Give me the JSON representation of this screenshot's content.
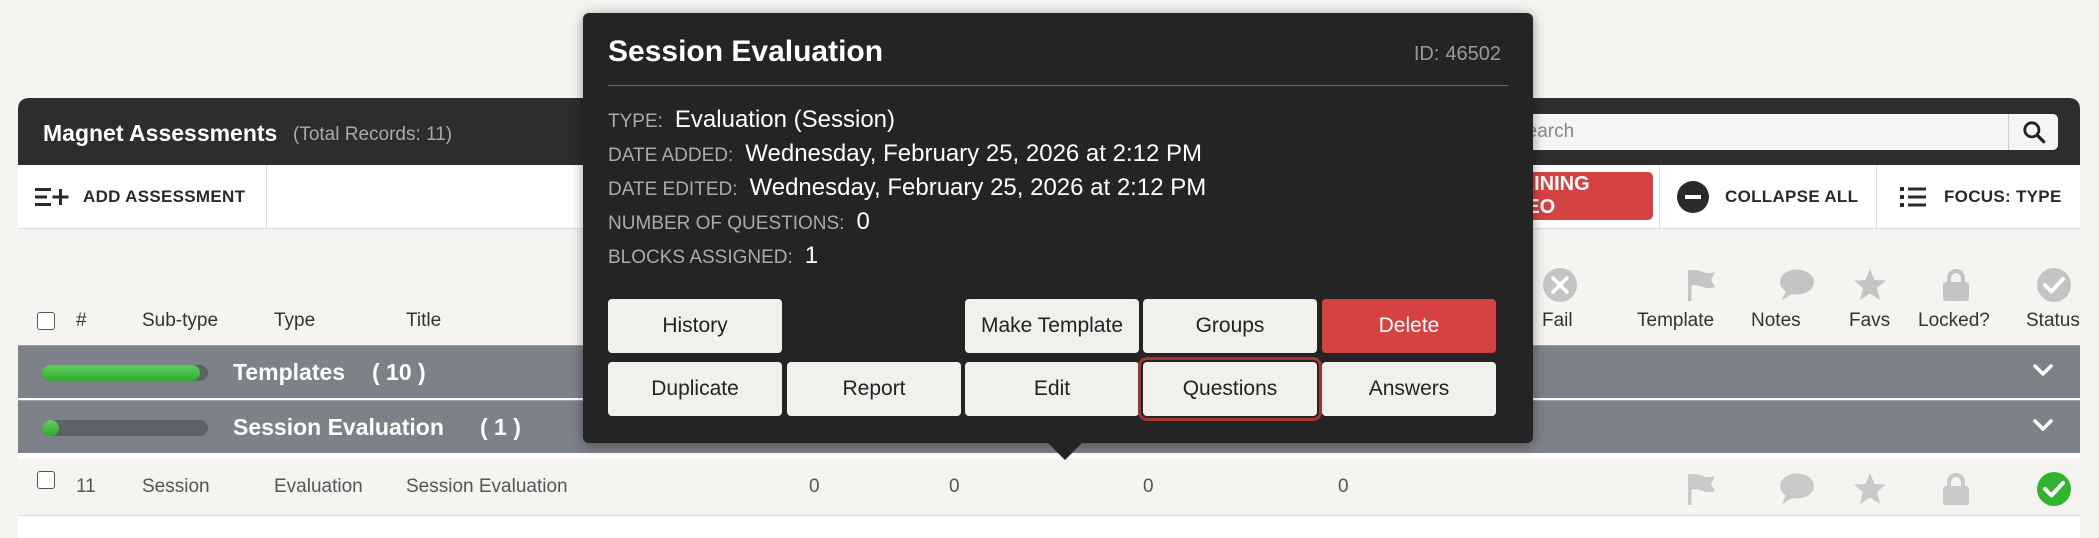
{
  "panel": {
    "title": "Magnet Assessments",
    "total_records": "(Total Records: 11)",
    "search_placeholder": "Search"
  },
  "toolbar": {
    "add_label": "ADD ASSESSMENT",
    "video_label": "TRAINING VIDEO",
    "collapse_label": "COLLAPSE ALL",
    "focus_label": "FOCUS: TYPE"
  },
  "columns": {
    "num": "#",
    "subtype": "Sub-type",
    "type": "Type",
    "title": "Title",
    "fail": "Fail",
    "template": "Template",
    "notes": "Notes",
    "favs": "Favs",
    "locked": "Locked?",
    "status": "Status"
  },
  "groups": [
    {
      "name": "Templates",
      "count": "( 10 )",
      "progress": 0.95
    },
    {
      "name": "Session Evaluation",
      "count": "( 1 )",
      "progress": 0.06
    }
  ],
  "row": {
    "num": "11",
    "subtype": "Session",
    "type": "Evaluation",
    "title": "Session Evaluation",
    "v1": "0",
    "v2": "0",
    "v3": "0",
    "v4": "0"
  },
  "popup": {
    "title": "Session Evaluation",
    "id_label": "ID:",
    "id_value": "46502",
    "type_label": "TYPE:",
    "type_value": "Evaluation (Session)",
    "added_label": "DATE ADDED:",
    "added_value": "Wednesday, February 25, 2026 at 2:12 PM",
    "edited_label": "DATE EDITED:",
    "edited_value": "Wednesday, February 25, 2026 at 2:12 PM",
    "questions_label": "NUMBER OF QUESTIONS:",
    "questions_value": "0",
    "blocks_label": "BLOCKS ASSIGNED:",
    "blocks_value": "1",
    "buttons": {
      "history": "History",
      "make_template": "Make Template",
      "groups": "Groups",
      "delete": "Delete",
      "duplicate": "Duplicate",
      "report": "Report",
      "edit": "Edit",
      "questions": "Questions",
      "answers": "Answers"
    }
  },
  "colors": {
    "header_bg": "#2d2d2d",
    "accent_red": "#d64141",
    "group_bg": "#7d8189",
    "progress_green": "#3fb83f",
    "status_green": "#2fb52f"
  }
}
